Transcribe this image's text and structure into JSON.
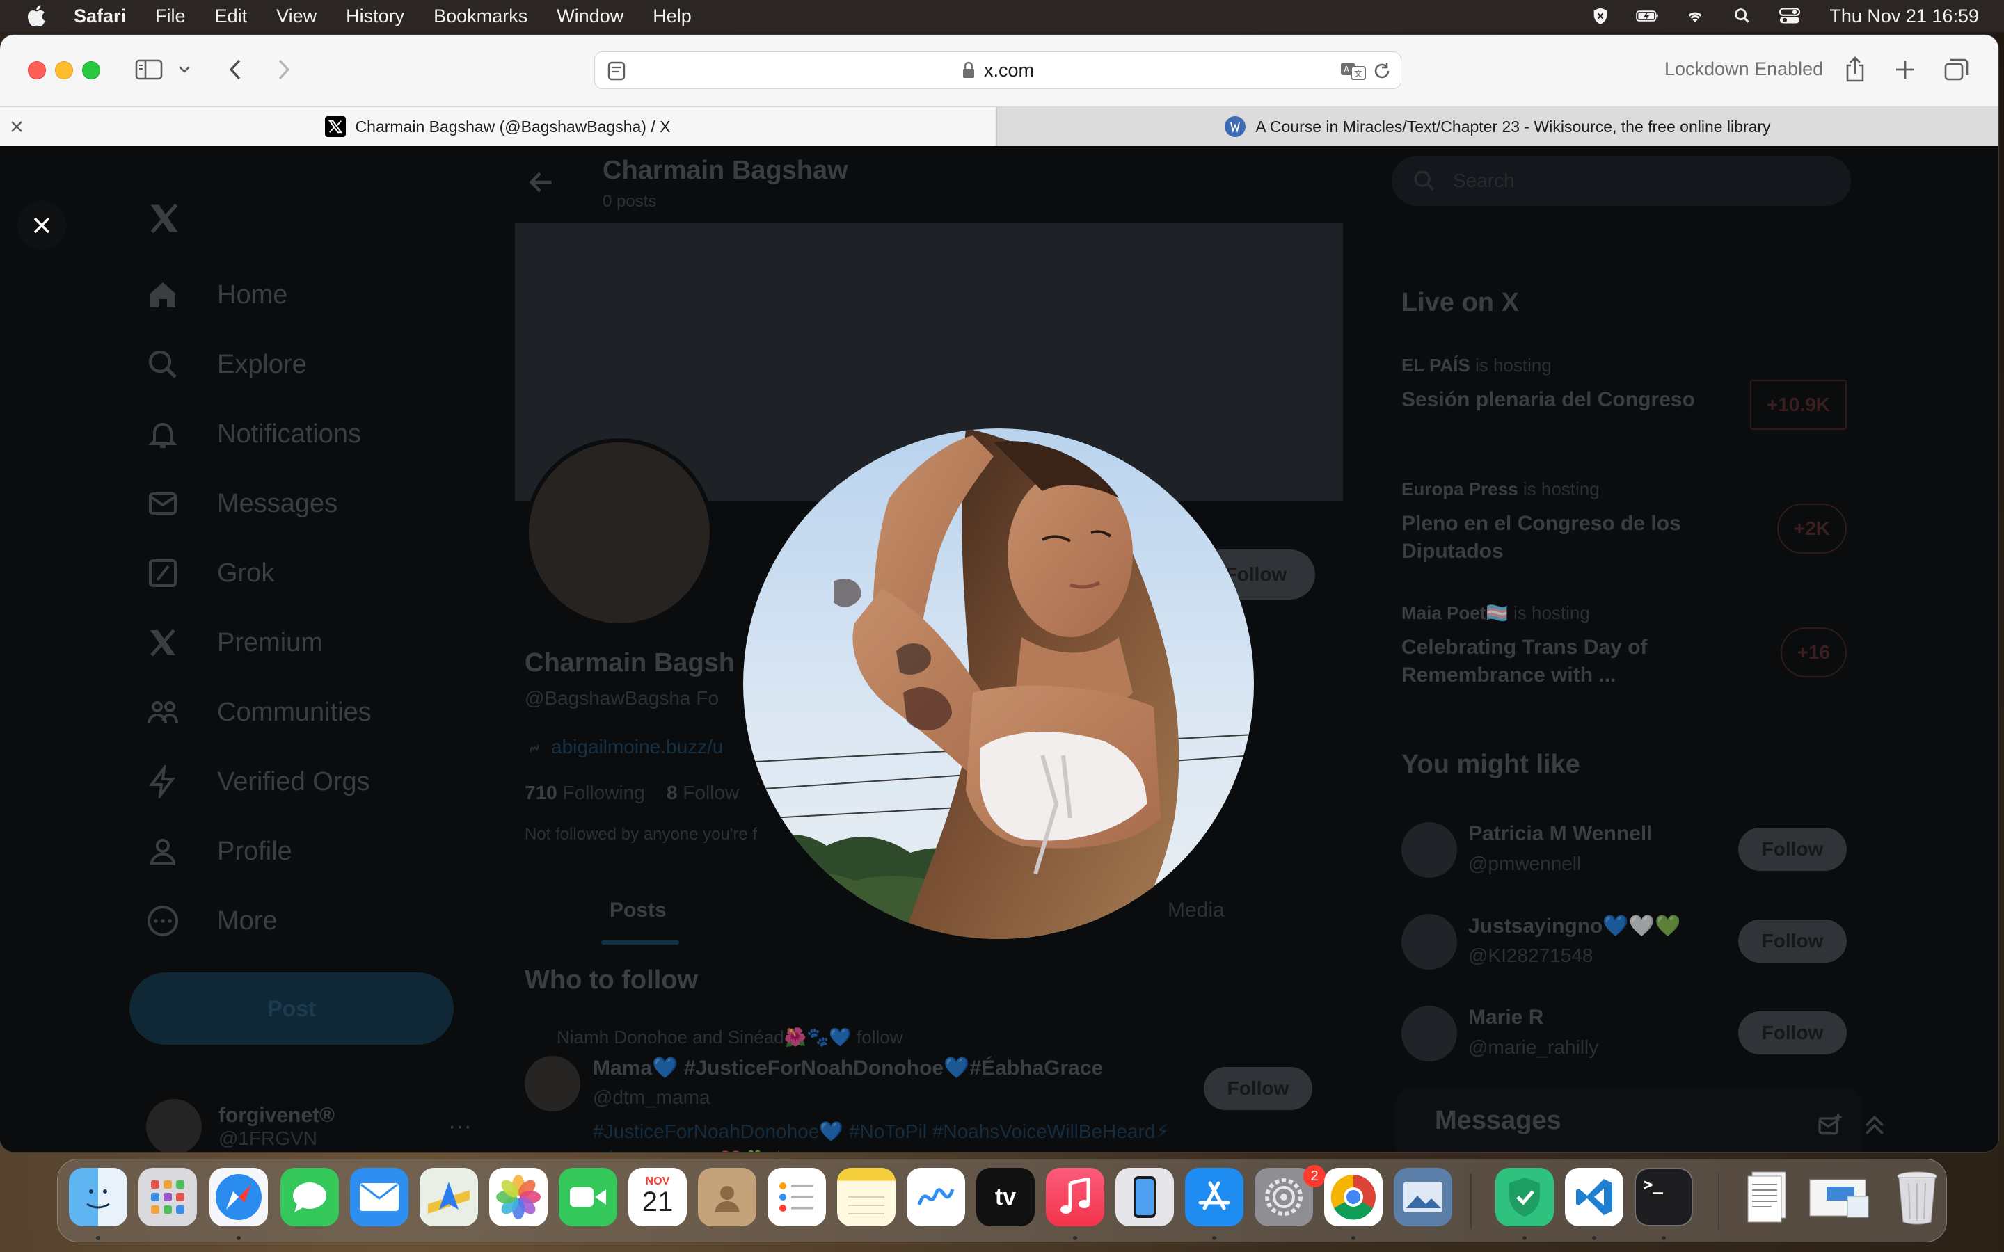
{
  "menubar": {
    "app": "Safari",
    "items": [
      "File",
      "Edit",
      "View",
      "History",
      "Bookmarks",
      "Window",
      "Help"
    ],
    "clock": "Thu Nov 21  16:59"
  },
  "browser": {
    "url": "x.com",
    "lockdown": "Lockdown Enabled",
    "tabs": [
      {
        "title": "Charmain Bagshaw (@BagshawBagsha) / X",
        "active": true
      },
      {
        "title": "A Course in Miracles/Text/Chapter 23 - Wikisource, the free online library",
        "active": false
      }
    ]
  },
  "x": {
    "nav": [
      "Home",
      "Explore",
      "Notifications",
      "Messages",
      "Grok",
      "Premium",
      "Communities",
      "Verified Orgs",
      "Profile",
      "More"
    ],
    "post_button": "Post",
    "account": {
      "name": "forgivenet®",
      "handle": "@1FRGVN",
      "more": "···"
    },
    "profile": {
      "title": "Charmain Bagshaw",
      "posts_count": "0 posts",
      "name": "Charmain Bagsh",
      "handle": "@BagshawBagsha",
      "handle_suffix": "Fo",
      "link": "abigailmoine.buzz/u",
      "following_count": "710",
      "following_label": "Following",
      "followers_count": "8",
      "followers_label": "Follow",
      "note": "Not followed by anyone you're f",
      "follow_button": "Follow",
      "tabs": {
        "posts": "Posts",
        "media": "Media"
      }
    },
    "who_to_follow": {
      "title": "Who to follow",
      "context": "Niamh Donohoe and Sinéad🌺🐾💙 follow",
      "name": "Mama💙 #JusticeForNoahDonohoe💙#ÉabhaGrace",
      "handle": "@dtm_mama",
      "bio": "#JusticeForNoahDonohoe💙 #NoToPil #NoahsVoiceWillBeHeard⚡ #ÉabhaGrace ❤️🍀🙌 #WarriorChild #DiffuseMidlineGlioma",
      "follow": "Follow"
    },
    "search_placeholder": "Search",
    "live": {
      "title": "Live on X",
      "items": [
        {
          "host": "EL PAÍS",
          "hosting": "is hosting",
          "topic": "Sesión plenaria del Congreso",
          "badge": "+10.9K"
        },
        {
          "host": "Europa Press",
          "hosting": "is hosting",
          "topic": "Pleno en el Congreso de los Diputados",
          "badge": "+2K"
        },
        {
          "host": "Maia Poet🏳️‍⚧️",
          "hosting": "is hosting",
          "topic": "Celebrating Trans Day of Remembrance with ...",
          "badge": "+16"
        }
      ]
    },
    "you_might_like": {
      "title": "You might like",
      "items": [
        {
          "name": "Patricia M Wennell",
          "handle": "@pmwennell",
          "follow": "Follow"
        },
        {
          "name": "Justsayingno💙🤍💚",
          "handle": "@KI28271548",
          "follow": "Follow"
        },
        {
          "name": "Marie R",
          "handle": "@marie_rahilly",
          "follow": "Follow"
        }
      ]
    },
    "messages_drawer": "Messages"
  },
  "dock": {
    "calendar_month": "NOV",
    "calendar_day": "21",
    "settings_badge": "2",
    "tv_label": "tv",
    "terminal_prompt": ">_"
  },
  "colors": {
    "x_blue": "#1d9bf0",
    "overlay": "#000000",
    "live_red": "#f4212e"
  }
}
